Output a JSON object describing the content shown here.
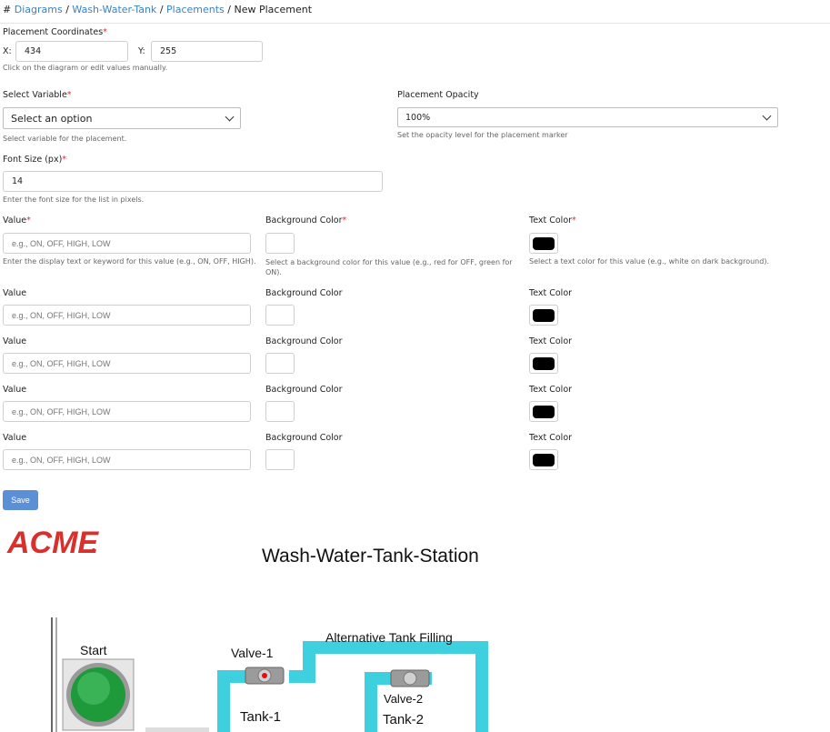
{
  "breadcrumb": {
    "prefix": "#",
    "diagrams": "Diagrams",
    "diagram_name": "Wash-Water-Tank",
    "placements": "Placements",
    "current": "New Placement",
    "sep": "/"
  },
  "coordinates": {
    "label": "Placement Coordinates",
    "x_label": "X:",
    "x_value": "434",
    "y_label": "Y:",
    "y_value": "255",
    "help": "Click on the diagram or edit values manually."
  },
  "variable": {
    "label": "Select Variable",
    "value": "Select an option",
    "help": "Select variable for the placement."
  },
  "opacity": {
    "label": "Placement Opacity",
    "value": "100%",
    "help": "Set the opacity level for the placement marker"
  },
  "font_size": {
    "label": "Font Size (px)",
    "value": "14",
    "help": "Enter the font size for the list in pixels."
  },
  "required_mark": "*",
  "value_rows": [
    {
      "value_label": "Value",
      "bg_label": "Background Color",
      "text_label": "Text Color",
      "placeholder": "e.g., ON, OFF, HIGH, LOW"
    },
    {
      "value_label": "Value",
      "bg_label": "Background Color",
      "text_label": "Text Color",
      "placeholder": "e.g., ON, OFF, HIGH, LOW"
    },
    {
      "value_label": "Value",
      "bg_label": "Background Color",
      "text_label": "Text Color",
      "placeholder": "e.g., ON, OFF, HIGH, LOW"
    },
    {
      "value_label": "Value",
      "bg_label": "Background Color",
      "text_label": "Text Color",
      "placeholder": "e.g., ON, OFF, HIGH, LOW"
    },
    {
      "value_label": "Value",
      "bg_label": "Background Color",
      "text_label": "Text Color",
      "placeholder": "e.g., ON, OFF, HIGH, LOW"
    }
  ],
  "value_help": "Enter the display text or keyword for this value (e.g., ON, OFF, HIGH).",
  "bg_help": "Select a background color for this value (e.g., red for OFF, green for ON).",
  "text_help": "Select a text color for this value (e.g., white on dark background).",
  "save_label": "Save",
  "diagram": {
    "logo": "ACME",
    "title": "Wash-Water-Tank-Station",
    "start": "Start",
    "valve1": "Valve-1",
    "valve2": "Valve-2",
    "alt_fill": "Alternative Tank Filling",
    "tank1": "Tank-1",
    "tank2": "Tank-2"
  },
  "colors": {
    "link": "#3b82c4",
    "accent": "#5b8fd6",
    "pipe": "#3fd0e0",
    "logo": "#d9302c",
    "button_green": "#1e9a3a"
  }
}
